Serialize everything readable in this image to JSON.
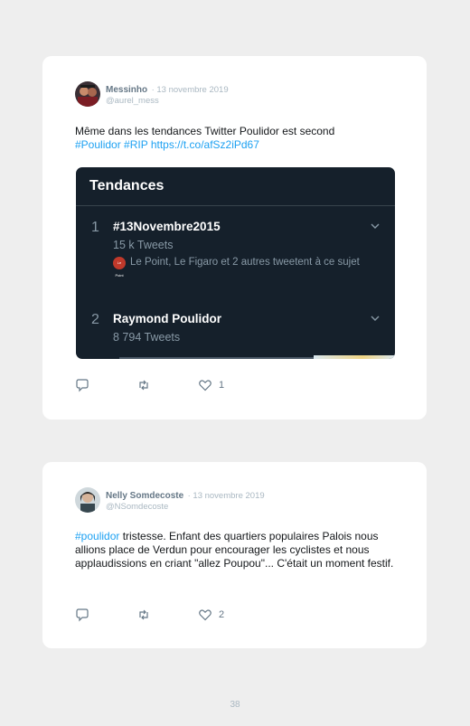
{
  "tweets": [
    {
      "author": "Messinho",
      "date": "· 13 novembre 2019",
      "handle": "@aurel_mess",
      "text": "Même dans les tendances Twitter Poulidor est second",
      "link_line": "#Poulidor #RIP https://t.co/afSz2iPd67",
      "likes": "1",
      "embed": {
        "title": "Tendances",
        "trends": [
          {
            "rank": "1",
            "name": "#13Novembre2015",
            "count": "15 k Tweets",
            "meta": "Le Point, Le Figaro et 2 autres tweetent à ce sujet",
            "logo": "Le Point"
          },
          {
            "rank": "2",
            "name": "Raymond Poulidor",
            "count": "8 794 Tweets"
          }
        ]
      }
    },
    {
      "author": "Nelly Somdecoste",
      "date": "· 13 novembre 2019",
      "handle": "@NSomdecoste",
      "hashtag": "#poulidor",
      "text": " tristesse. Enfant des quartiers populaires Palois nous allions place de Verdun pour encourager les cyclistes et nous applaudissions en criant \"allez Poupou\"... C'était un moment festif.",
      "likes": "2"
    }
  ],
  "page_number": "38",
  "colors": {
    "link": "#1da1f2",
    "muted": "#657786",
    "embed_bg": "#15202b"
  },
  "icons": [
    "reply-icon",
    "retweet-icon",
    "heart-icon",
    "chevron-down-icon"
  ]
}
